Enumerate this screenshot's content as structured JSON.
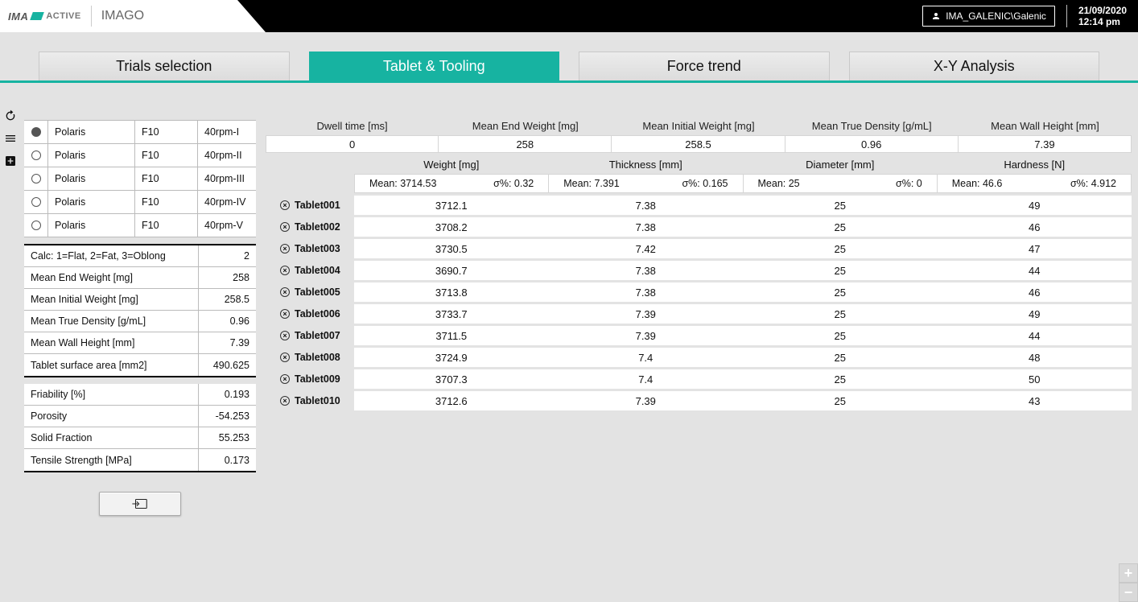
{
  "brand": {
    "logo_text_a": "IMA",
    "logo_text_b": "ACTIVE",
    "app_name": "IMAGO"
  },
  "header": {
    "user": "IMA_GALENIC\\Galenic",
    "date": "21/09/2020",
    "time": "12:14 pm"
  },
  "tabs": [
    {
      "label": "Trials selection",
      "active": false
    },
    {
      "label": "Tablet & Tooling",
      "active": true
    },
    {
      "label": "Force trend",
      "active": false
    },
    {
      "label": "X-Y Analysis",
      "active": false
    }
  ],
  "trials": [
    {
      "name": "Polaris",
      "code": "F10",
      "variant": "40rpm-I",
      "selected": true
    },
    {
      "name": "Polaris",
      "code": "F10",
      "variant": "40rpm-II",
      "selected": false
    },
    {
      "name": "Polaris",
      "code": "F10",
      "variant": "40rpm-III",
      "selected": false
    },
    {
      "name": "Polaris",
      "code": "F10",
      "variant": "40rpm-IV",
      "selected": false
    },
    {
      "name": "Polaris",
      "code": "F10",
      "variant": "40rpm-V",
      "selected": false
    }
  ],
  "params_a": [
    {
      "label": "Calc: 1=Flat, 2=Fat, 3=Oblong",
      "value": "2"
    },
    {
      "label": "Mean End Weight [mg]",
      "value": "258"
    },
    {
      "label": "Mean Initial Weight [mg]",
      "value": "258.5"
    },
    {
      "label": "Mean True Density [g/mL]",
      "value": "0.96"
    },
    {
      "label": "Mean Wall Height [mm]",
      "value": "7.39"
    },
    {
      "label": "Tablet surface area [mm2]",
      "value": "490.625"
    }
  ],
  "params_b": [
    {
      "label": "Friability [%]",
      "value": "0.193"
    },
    {
      "label": "Porosity",
      "value": "-54.253"
    },
    {
      "label": "Solid Fraction",
      "value": "55.253"
    },
    {
      "label": "Tensile Strength [MPa]",
      "value": "0.173"
    }
  ],
  "summary_cols": [
    {
      "label": "Dwell time [ms]",
      "value": "0"
    },
    {
      "label": "Mean End Weight [mg]",
      "value": "258"
    },
    {
      "label": "Mean Initial Weight [mg]",
      "value": "258.5"
    },
    {
      "label": "Mean True Density [g/mL]",
      "value": "0.96"
    },
    {
      "label": "Mean Wall Height [mm]",
      "value": "7.39"
    }
  ],
  "measure_cols": [
    {
      "label": "Weight [mg]",
      "mean": "Mean: 3714.53",
      "sigma": "σ%: 0.32"
    },
    {
      "label": "Thickness [mm]",
      "mean": "Mean: 7.391",
      "sigma": "σ%: 0.165"
    },
    {
      "label": "Diameter [mm]",
      "mean": "Mean: 25",
      "sigma": "σ%: 0"
    },
    {
      "label": "Hardness [N]",
      "mean": "Mean: 46.6",
      "sigma": "σ%: 4.912"
    }
  ],
  "rows": [
    {
      "name": "Tablet001",
      "vals": [
        "3712.1",
        "7.38",
        "25",
        "49"
      ]
    },
    {
      "name": "Tablet002",
      "vals": [
        "3708.2",
        "7.38",
        "25",
        "46"
      ]
    },
    {
      "name": "Tablet003",
      "vals": [
        "3730.5",
        "7.42",
        "25",
        "47"
      ]
    },
    {
      "name": "Tablet004",
      "vals": [
        "3690.7",
        "7.38",
        "25",
        "44"
      ]
    },
    {
      "name": "Tablet005",
      "vals": [
        "3713.8",
        "7.38",
        "25",
        "46"
      ]
    },
    {
      "name": "Tablet006",
      "vals": [
        "3733.7",
        "7.39",
        "25",
        "49"
      ]
    },
    {
      "name": "Tablet007",
      "vals": [
        "3711.5",
        "7.39",
        "25",
        "44"
      ]
    },
    {
      "name": "Tablet008",
      "vals": [
        "3724.9",
        "7.4",
        "25",
        "48"
      ]
    },
    {
      "name": "Tablet009",
      "vals": [
        "3707.3",
        "7.4",
        "25",
        "50"
      ]
    },
    {
      "name": "Tablet010",
      "vals": [
        "3712.6",
        "7.39",
        "25",
        "43"
      ]
    }
  ]
}
